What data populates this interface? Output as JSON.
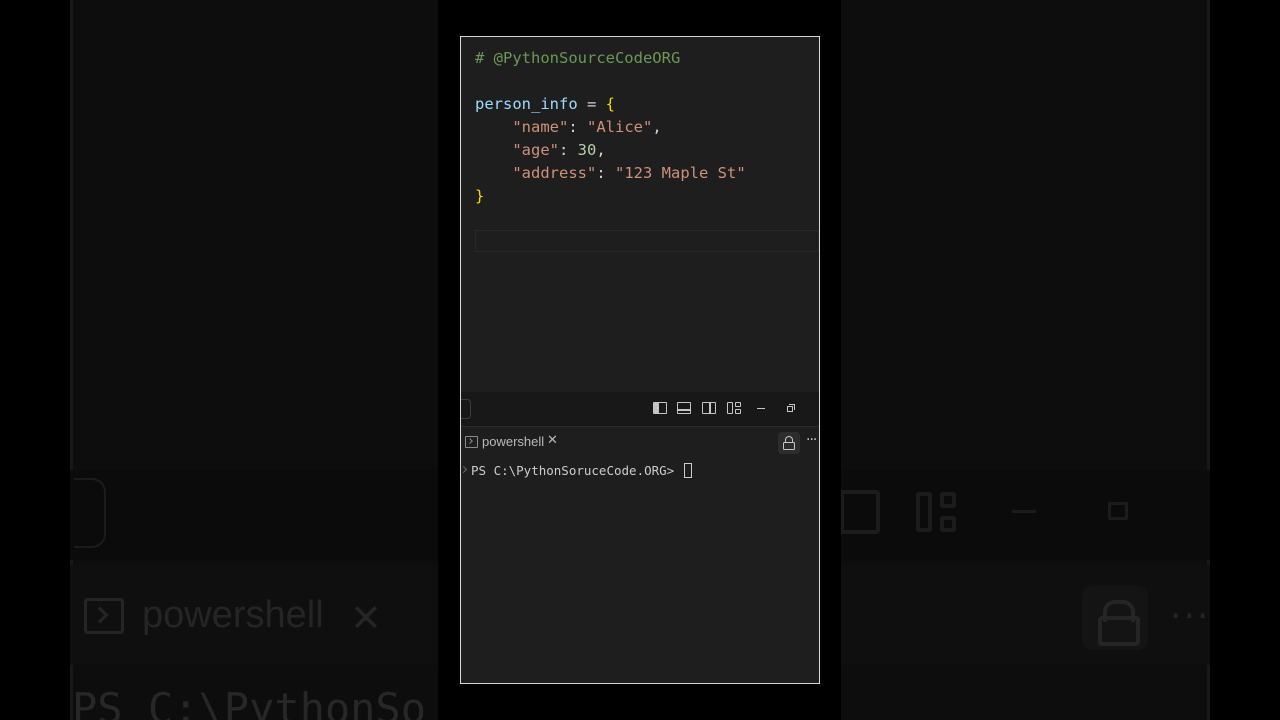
{
  "editor": {
    "lines": [
      [
        {
          "t": "# @PythonSourceCodeORG",
          "c": "comment"
        }
      ],
      [],
      [
        {
          "t": "person_info",
          "c": "var"
        },
        {
          "t": " = ",
          "c": "op"
        },
        {
          "t": "{",
          "c": "brace"
        }
      ],
      [
        {
          "t": "    ",
          "c": "op"
        },
        {
          "t": "\"name\"",
          "c": "str"
        },
        {
          "t": ": ",
          "c": "op"
        },
        {
          "t": "\"Alice\"",
          "c": "str"
        },
        {
          "t": ",",
          "c": "op"
        }
      ],
      [
        {
          "t": "    ",
          "c": "op"
        },
        {
          "t": "\"age\"",
          "c": "str"
        },
        {
          "t": ": ",
          "c": "op"
        },
        {
          "t": "30",
          "c": "num"
        },
        {
          "t": ",",
          "c": "op"
        }
      ],
      [
        {
          "t": "    ",
          "c": "op"
        },
        {
          "t": "\"address\"",
          "c": "str"
        },
        {
          "t": ": ",
          "c": "op"
        },
        {
          "t": "\"123 Maple St\"",
          "c": "str"
        }
      ],
      [
        {
          "t": "}",
          "c": "brace"
        }
      ]
    ]
  },
  "toolbar": {
    "icons": [
      "sidebar-left-icon",
      "panel-icon",
      "sidebar-right-icon",
      "layout-icon",
      "minimize-icon",
      "restore-icon"
    ]
  },
  "terminal": {
    "tab_label": "powershell",
    "tab_close": "✕",
    "more": "···",
    "prompt": "PS C:\\PythonSoruceCode.ORG> "
  },
  "backdrop": {
    "tab_label": "powershell",
    "close": "✕",
    "prompt": "PS C:\\PythonSo",
    "more": "···"
  },
  "colors": {
    "comment": "#6a9955",
    "variable": "#9cdcfe",
    "brace": "#ffd700",
    "string": "#ce9178",
    "number": "#b5cea8",
    "editor_bg": "#1e1e1e"
  }
}
